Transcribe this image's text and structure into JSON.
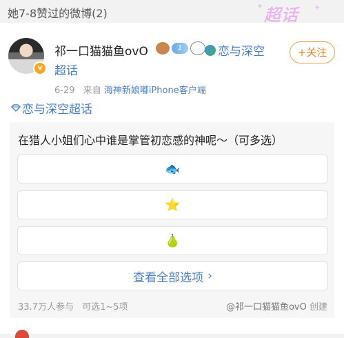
{
  "header": {
    "title": "她7-8赞过的微博(2)",
    "badge_label": "超话"
  },
  "post": {
    "username": "祁一口猫猫鱼ovO",
    "level_badge": "1",
    "topic_name": "恋与深空",
    "topic_suffix": "超话",
    "follow_label": "+关注",
    "date": "6-29",
    "source_prefix": "来自",
    "source_device": "海神新娘嘟iPhone客户端",
    "topic_tag": "恋与深空超话"
  },
  "poll": {
    "question": "在猎人小姐们心中谁是掌管初恋感的神呢～（可多选）",
    "options": [
      {
        "emoji": "🐟",
        "icon": "fish-icon"
      },
      {
        "emoji": "⭐",
        "icon": "star-icon"
      },
      {
        "emoji": "🍐",
        "icon": "pear-icon"
      }
    ],
    "view_all_label": "查看全部选项",
    "participants": "33.7万人参与",
    "choice_rule": "可选1~5项",
    "creator": "@祁一口猫猫鱼ovO",
    "created_suffix": "创建"
  },
  "colors": {
    "link": "#4a7fc1",
    "follow": "#e8852c",
    "badge": "#e9b7ee"
  }
}
